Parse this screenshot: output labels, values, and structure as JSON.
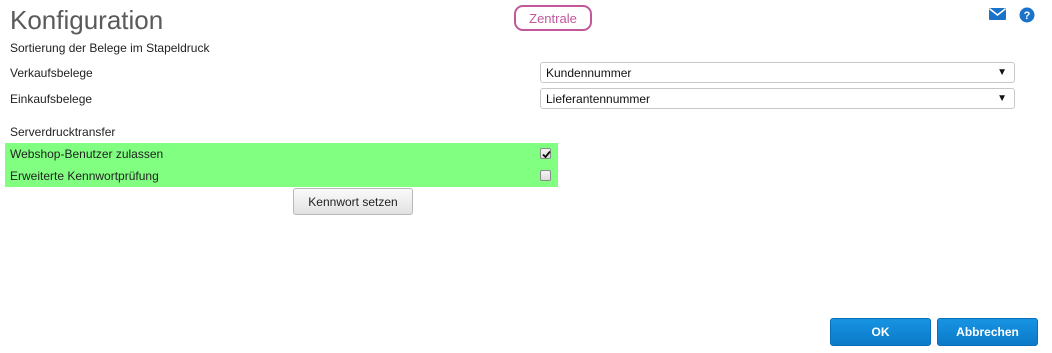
{
  "header": {
    "title": "Konfiguration",
    "tenant_label": "Zentrale",
    "icons": [
      "mail-icon",
      "help-icon"
    ]
  },
  "sorting": {
    "section_label": "Sortierung der Belege im Stapeldruck",
    "rows": [
      {
        "label": "Verkaufsbelege",
        "selected": "Kundennummer"
      },
      {
        "label": "Einkaufsbelege",
        "selected": "Lieferantennummer"
      }
    ]
  },
  "transfer": {
    "section_label": "Serverdrucktransfer",
    "options": [
      {
        "label": "Webshop-Benutzer zulassen",
        "checked": true
      },
      {
        "label": "Erweiterte Kennwortprüfung",
        "checked": false
      }
    ],
    "set_password_label": "Kennwort setzen"
  },
  "footer": {
    "ok_label": "OK",
    "cancel_label": "Abbrechen"
  },
  "colors": {
    "accent_blue": "#0b79c7",
    "tenant_border": "#c0589a",
    "highlight_green": "#80ff80"
  }
}
